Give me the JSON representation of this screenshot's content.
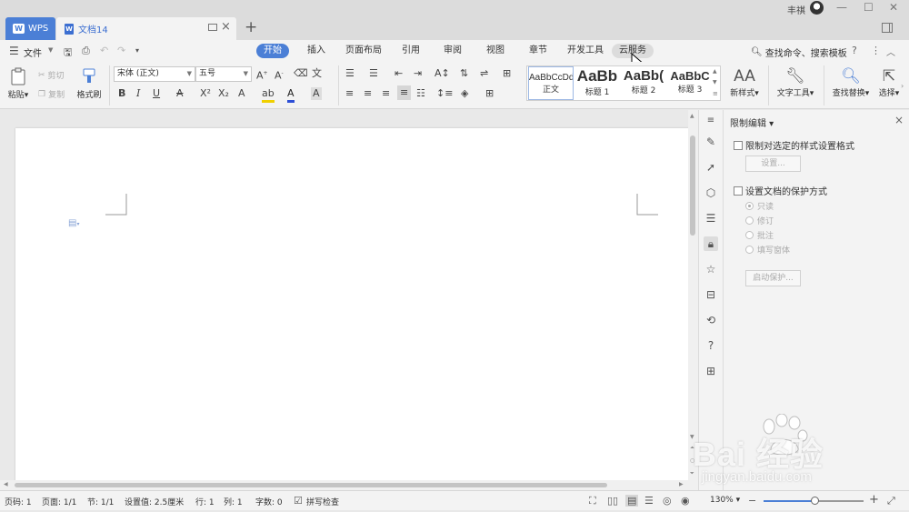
{
  "titlebar": {
    "app_tab": "WPS",
    "doc_tab": "文档14",
    "user": "丰祺"
  },
  "menu": {
    "file": "文件",
    "tabs": [
      "开始",
      "插入",
      "页面布局",
      "引用",
      "审阅",
      "视图",
      "章节",
      "开发工具",
      "云服务"
    ],
    "active_tab": "开始",
    "hover_tab": "云服务",
    "search": "查找命令、搜索模板"
  },
  "ribbon": {
    "paste": "粘贴",
    "cut": "剪切",
    "copy": "复制",
    "format_painter": "格式刷",
    "font_name": "宋体 (正文)",
    "font_size": "五号",
    "styles": [
      {
        "sample": "AaBbCcDd",
        "label": "正文"
      },
      {
        "sample": "AaBb",
        "label": "标题 1"
      },
      {
        "sample": "AaBb(",
        "label": "标题 2"
      },
      {
        "sample": "AaBbC",
        "label": "标题 3"
      }
    ],
    "new_style": "新样式",
    "text_tools": "文字工具",
    "find_replace": "查找替换",
    "select": "选择"
  },
  "panel": {
    "title": "限制编辑",
    "limit_format": "限制对选定的样式设置格式",
    "settings_btn": "设置...",
    "protect_mode": "设置文档的保护方式",
    "options": [
      "只读",
      "修订",
      "批注",
      "填写窗体"
    ],
    "start_btn": "启动保护..."
  },
  "status": {
    "page_no": "页码: 1",
    "pages": "页面: 1/1",
    "section": "节: 1/1",
    "setting": "设置值: 2.5厘米",
    "row": "行: 1",
    "col": "列: 1",
    "words": "字数: 0",
    "spell": "拼写检查",
    "zoom": "130%",
    "zoom_level": 0.52
  },
  "watermark": {
    "main": "Bai 经验",
    "sub": "jingyan.baidu.com"
  }
}
